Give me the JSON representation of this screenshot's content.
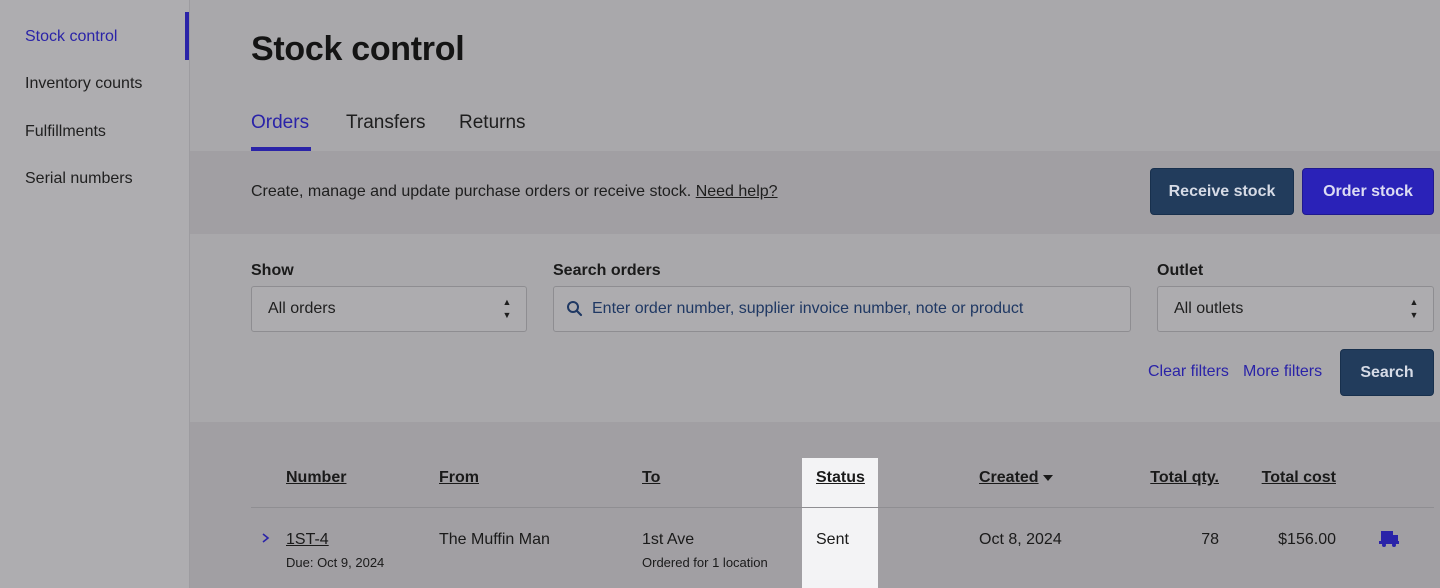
{
  "sidebar": {
    "items": [
      {
        "label": "Stock control",
        "active": true
      },
      {
        "label": "Inventory counts"
      },
      {
        "label": "Fulfillments"
      },
      {
        "label": "Serial numbers"
      }
    ]
  },
  "page": {
    "title": "Stock control",
    "tabs": [
      {
        "label": "Orders",
        "active": true
      },
      {
        "label": "Transfers"
      },
      {
        "label": "Returns"
      }
    ]
  },
  "banner": {
    "text": "Create, manage and update purchase orders or receive stock.",
    "help_link": "Need help?",
    "receive_button": "Receive stock",
    "order_button": "Order stock"
  },
  "filters": {
    "show_label": "Show",
    "show_value": "All orders",
    "search_label": "Search orders",
    "search_placeholder": "Enter order number, supplier invoice number, note or product",
    "outlet_label": "Outlet",
    "outlet_value": "All outlets",
    "clear_link": "Clear filters",
    "more_link": "More filters",
    "search_button": "Search"
  },
  "table": {
    "columns": [
      "Number",
      "From",
      "To",
      "Status",
      "Created",
      "Total qty.",
      "Total cost"
    ],
    "sorted_column": "Created",
    "rows": [
      {
        "number": "1ST-4",
        "due": "Due: Oct 9, 2024",
        "from": "The Muffin Man",
        "to": "1st Ave",
        "to_sub": "Ordered for 1 location",
        "status": "Sent",
        "created": "Oct 8, 2024",
        "total_qty": "78",
        "total_cost": "$156.00",
        "icon": "receive-truck-icon"
      }
    ]
  },
  "colors": {
    "accent": "#2a23a8",
    "primary_button": "#2a22b8",
    "secondary_button": "#223c5c"
  }
}
